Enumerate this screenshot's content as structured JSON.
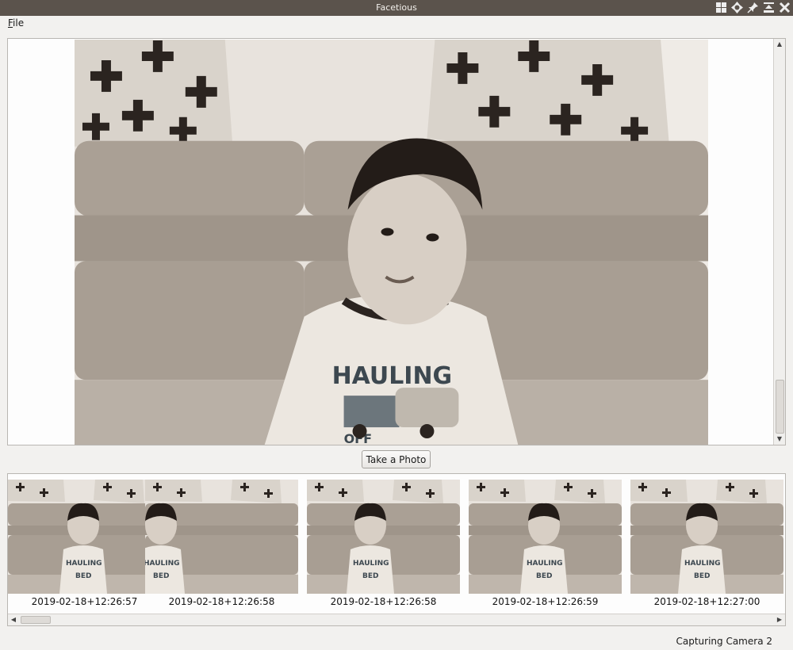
{
  "window": {
    "title": "Facetious",
    "controls": [
      "grid-icon",
      "move-icon",
      "pin-icon",
      "minimize-icon",
      "close-icon"
    ]
  },
  "menubar": {
    "items": [
      {
        "label": "File",
        "mnemonic": "F",
        "rest": "ile"
      }
    ]
  },
  "viewer": {
    "photo": {
      "subject": "toddler-on-couch",
      "shirt_text": [
        "HAULING",
        "OFF"
      ]
    },
    "vertical_scroll_position": 0.83
  },
  "actions": {
    "take_photo_label": "Take a Photo"
  },
  "gallery": {
    "photos": [
      {
        "timestamp": "2019-02-18+12:26:57",
        "shirt_text": [
          "HAULING",
          "BED"
        ]
      },
      {
        "timestamp": "2019-02-18+12:26:58",
        "shirt_text": [
          "HAULING",
          "BED"
        ]
      },
      {
        "timestamp": "2019-02-18+12:26:58",
        "shirt_text": [
          "HAULING",
          "BED"
        ]
      },
      {
        "timestamp": "2019-02-18+12:26:59",
        "shirt_text": [
          "HAULING",
          "BED"
        ]
      },
      {
        "timestamp": "2019-02-18+12:27:00",
        "shirt_text": [
          "HAULING",
          "BED"
        ]
      }
    ],
    "horizontal_scroll_position": 0.0
  },
  "status": {
    "text": "Capturing Camera 2"
  },
  "colors": {
    "titlebar": "#5b534c",
    "window_bg": "#f2f1ef",
    "photo_wall": "#e8e3dd",
    "sofa": "#a59b90",
    "pillow_dark": "#2b2420"
  }
}
